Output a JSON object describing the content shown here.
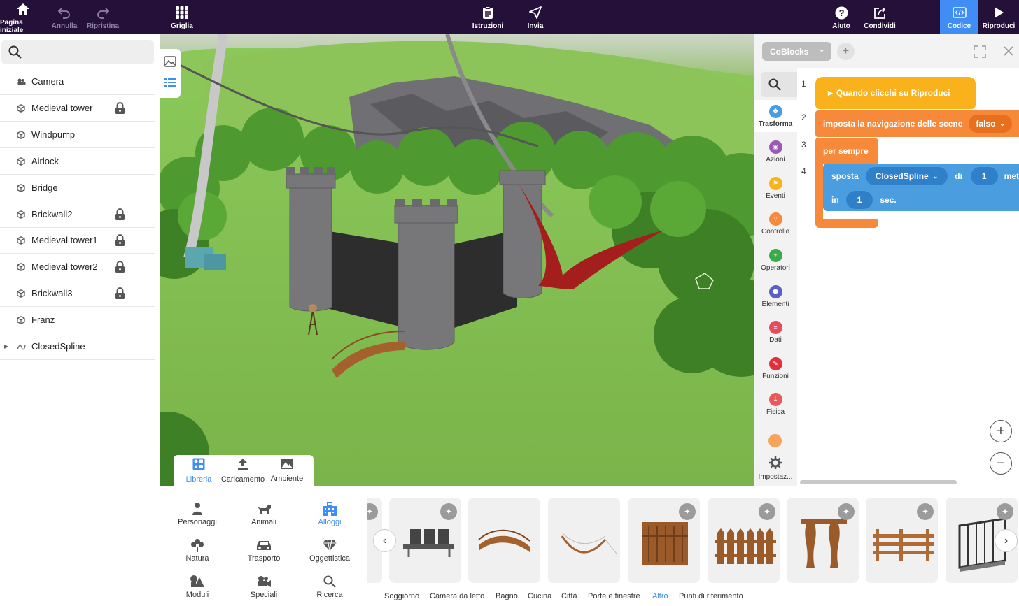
{
  "topbar": {
    "home": "Pagina iniziale",
    "undo": "Annulla",
    "redo": "Ripristina",
    "grid": "Griglia",
    "instructions": "Istruzioni",
    "send": "Invia",
    "help": "Aiuto",
    "share": "Condividi",
    "code": "Codice",
    "play": "Riproduci"
  },
  "scene_tree": {
    "items": [
      {
        "label": "Camera",
        "locked": false
      },
      {
        "label": "Medieval tower",
        "locked": true
      },
      {
        "label": "Windpump",
        "locked": false
      },
      {
        "label": "Airlock",
        "locked": false
      },
      {
        "label": "Bridge",
        "locked": false
      },
      {
        "label": "Brickwall2",
        "locked": true
      },
      {
        "label": "Medieval tower1",
        "locked": true
      },
      {
        "label": "Medieval tower2",
        "locked": true
      },
      {
        "label": "Brickwall3",
        "locked": true
      },
      {
        "label": "Franz",
        "locked": false
      },
      {
        "label": "ClosedSpline",
        "locked": false
      }
    ]
  },
  "library": {
    "tabs": [
      "Libreria",
      "Caricamento",
      "Ambiente"
    ],
    "categories": [
      "Personaggi",
      "Animali",
      "Alloggi",
      "Natura",
      "Trasporto",
      "Oggettistica",
      "Moduli",
      "Speciali",
      "Ricerca"
    ],
    "selected_category": "Alloggi",
    "subcategories": [
      "Soggiorno",
      "Camera da letto",
      "Bagno",
      "Cucina",
      "Città",
      "Porte e finestre",
      "Altro",
      "Punti di riferimento"
    ],
    "selected_subcategory": "Altro"
  },
  "code": {
    "selector": "CoBlocks",
    "categories": [
      "Trasforma",
      "Azioni",
      "Eventi",
      "Controllo",
      "Operatori",
      "Elementi",
      "Dati",
      "Funzioni",
      "Fisica"
    ],
    "settings": "Impostaz...",
    "line_numbers": [
      "1",
      "2",
      "3",
      "4"
    ],
    "blocks": {
      "when_play": "Quando clicchi su Riproduci",
      "set_nav": "imposta la navigazione delle scene",
      "set_nav_value": "falso",
      "forever": "per sempre",
      "move": "sposta",
      "move_target": "ClosedSpline",
      "move_of": "di",
      "move_amount": "1",
      "move_unit": "met",
      "in": "in",
      "duration": "1",
      "sec": "sec."
    }
  },
  "colors": {
    "topbar": "#25103a",
    "accent": "#3f8df5",
    "event_block": "#f9b21c",
    "control_block": "#f7893a",
    "transform_block": "#4a9ee0"
  }
}
